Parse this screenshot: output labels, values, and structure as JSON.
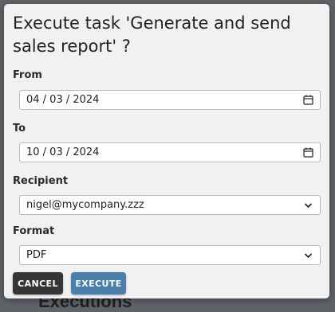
{
  "background": {
    "heading_partial": "Executions"
  },
  "dialog": {
    "title": "Execute task 'Generate and send sales report' ?",
    "fields": {
      "from": {
        "label": "From",
        "value": "04 / 03 / 2024",
        "icon": "calendar-icon"
      },
      "to": {
        "label": "To",
        "value": "10 / 03 / 2024",
        "icon": "calendar-icon"
      },
      "recipient": {
        "label": "Recipient",
        "value": "nigel@mycompany.zzz",
        "icon": "chevron-down-icon"
      },
      "format": {
        "label": "Format",
        "value": "PDF",
        "icon": "chevron-down-icon"
      }
    },
    "buttons": {
      "cancel": "CANCEL",
      "execute": "EXECUTE"
    }
  },
  "colors": {
    "overlay": "#5f6266",
    "dialog_bg": "#f1f1f1",
    "cancel_button": "#353535",
    "execute_button": "#4a7fac"
  }
}
